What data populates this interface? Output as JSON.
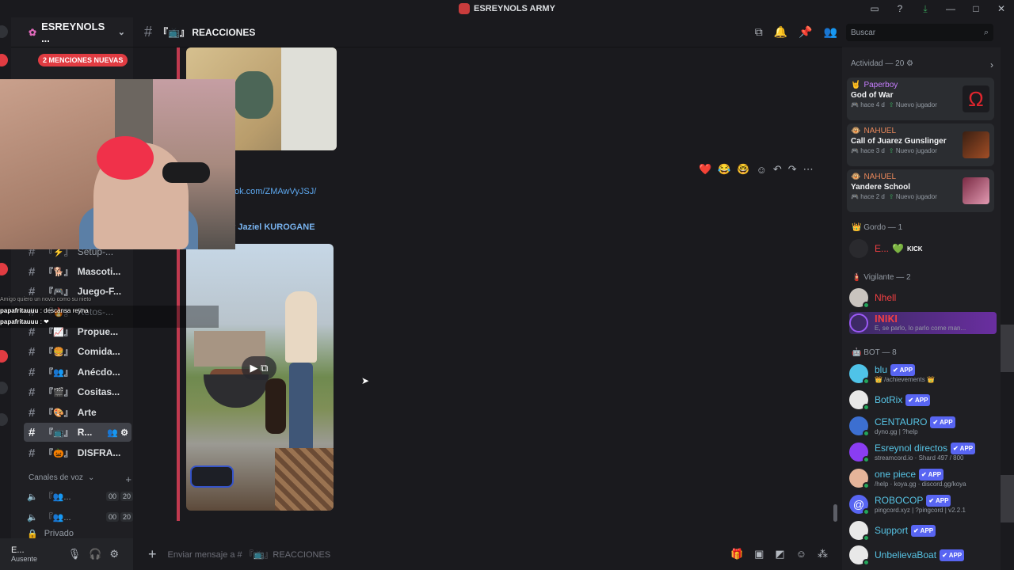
{
  "window": {
    "title": "ESREYNOLS ARMY",
    "controls": [
      "—",
      "□",
      "✕"
    ]
  },
  "guild": {
    "name": "ESREYNOLS ...",
    "mentions_pill": "2 MENCIONES NUEVAS"
  },
  "channels": [
    {
      "emoji": "⚡",
      "name": "Setup-...",
      "active": false
    },
    {
      "emoji": "🐕",
      "name": "Mascoti...",
      "active": false
    },
    {
      "emoji": "🎮",
      "name": "Juego-F...",
      "active": false
    },
    {
      "emoji": "🔥",
      "name": "Retos-...",
      "active": false
    },
    {
      "emoji": "📈",
      "name": "Propue...",
      "active": false
    },
    {
      "emoji": "🍔",
      "name": "Comida...",
      "active": false
    },
    {
      "emoji": "👥",
      "name": "Anécdo...",
      "active": false
    },
    {
      "emoji": "🎬",
      "name": "Cositas...",
      "active": false
    },
    {
      "emoji": "🎨",
      "name": "Arte",
      "active": false
    },
    {
      "emoji": "📺",
      "name": "R...",
      "active": true
    },
    {
      "emoji": "🎃",
      "name": "DISFRA...",
      "active": false
    }
  ],
  "voice": {
    "heading": "Canales de voz",
    "channels": [
      {
        "name": "👥...",
        "a": "00",
        "b": "20"
      },
      {
        "name": "👥...",
        "a": "00",
        "b": "20"
      }
    ],
    "private_label": "Privado"
  },
  "user": {
    "name": "E...",
    "status": "Ausente"
  },
  "channel": {
    "name": "REACCIONES",
    "emoji": "📺"
  },
  "messages": {
    "link": "ok.com/ZMAwVyJSJ/",
    "reply_author": "r Jaziel KUROGANE"
  },
  "reactions": [
    "❤️",
    "😂",
    "🤓"
  ],
  "composer": {
    "placeholder": "Enviar mensaje a # 『📺』REACCIONES"
  },
  "stream_chat": [
    {
      "user": "papafritauuu",
      "text": ": descansa reyna"
    },
    {
      "user": "papafritauuu",
      "text": ": ❤"
    }
  ],
  "stream_chat_faint": "Amigo quiero un novio como su nieto",
  "search": {
    "placeholder": "Buscar"
  },
  "activity": {
    "heading": "Actividad — 20",
    "items": [
      {
        "user": "Paperboy",
        "user_color": "#c77dff",
        "game": "God of War",
        "time": "hace 4 d",
        "tag": "Nuevo jugador",
        "thumb": "#1b1b1f"
      },
      {
        "user": "NAHUEL",
        "user_color": "#e8875a",
        "game": "Call of Juarez Gunslinger",
        "time": "hace 3 d",
        "tag": "Nuevo jugador",
        "thumb": "#6b3a22"
      },
      {
        "user": "NAHUEL",
        "user_color": "#e8875a",
        "game": "Yandere School",
        "time": "hace 2 d",
        "tag": "Nuevo jugador",
        "thumb": "#c26a87"
      }
    ]
  },
  "roles": [
    {
      "name": "Gordo — 1",
      "icon": "👑"
    },
    {
      "name": "Vigilante — 2",
      "icon": "🧯"
    },
    {
      "name": "BOT — 8",
      "icon": "🤖"
    }
  ],
  "members": {
    "gordo": [
      {
        "name": "E...",
        "color": "#f23f43",
        "badge": "KICK"
      }
    ],
    "vigilante": [
      {
        "name": "Nhell",
        "color": "#f23f43",
        "sub": ""
      },
      {
        "name": "𝐈𝐍𝐈𝐊𝐈",
        "color": "#f23f43",
        "sub": "E, se parlo, lo parlo come man..."
      }
    ],
    "bots": [
      {
        "name": "blu",
        "color": "#57c4e5",
        "sub": "👑 /achievements 👑",
        "av": "#4fc3e8"
      },
      {
        "name": "BotRix",
        "color": "#57c4e5",
        "sub": "",
        "av": "#e8e8e8"
      },
      {
        "name": "CENTAURO",
        "color": "#57c4e5",
        "sub": "dyno.gg | ?help",
        "av": "#3c6fd1"
      },
      {
        "name": "Esreynol directos",
        "color": "#57c4e5",
        "sub": "streamcord.io · Shard 497 / 800",
        "av": "#8a3df2"
      },
      {
        "name": "one piece",
        "color": "#57c4e5",
        "sub": "/help · koya.gg · discord.gg/koya",
        "av": "#e5b49a"
      },
      {
        "name": "ROBOCOP",
        "color": "#57c4e5",
        "sub": "pingcord.xyz | ?pingcord | v2.2.1",
        "av": "#5865f2"
      },
      {
        "name": "Support",
        "color": "#57c4e5",
        "sub": "",
        "av": "#e8e8e8"
      },
      {
        "name": "UnbelievaBoat",
        "color": "#57c4e5",
        "sub": "",
        "av": "#e8e8e8"
      }
    ],
    "app_label": "✔ APP"
  }
}
